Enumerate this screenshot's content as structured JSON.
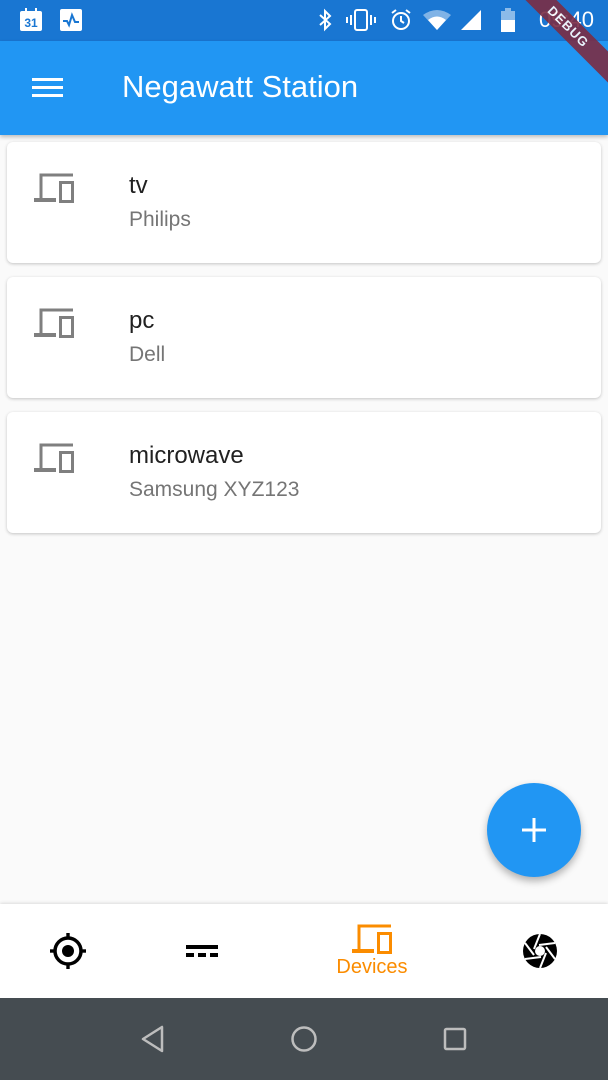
{
  "status_bar": {
    "left_icons": [
      "calendar-icon",
      "pulse-activity-icon"
    ],
    "calendar_day": "31",
    "right_icons": [
      "bluetooth-icon",
      "vibrate-icon",
      "alarm-icon",
      "wifi-icon",
      "signal-icon",
      "battery-icon"
    ],
    "time": "09:40"
  },
  "debug_banner": "DEBUG",
  "app_bar": {
    "menu_icon": "menu-icon",
    "title": "Negawatt Station"
  },
  "devices": [
    {
      "name": "tv",
      "brand": "Philips",
      "icon": "devices-icon"
    },
    {
      "name": "pc",
      "brand": "Dell",
      "icon": "devices-icon"
    },
    {
      "name": "microwave",
      "brand": "Samsung XYZ123",
      "icon": "devices-icon"
    }
  ],
  "fab": {
    "icon": "add-icon",
    "label": "+"
  },
  "bottom_nav": {
    "items": [
      {
        "icon": "gps-fixed-icon",
        "label": "",
        "active": false
      },
      {
        "icon": "power-input-icon",
        "label": "",
        "active": false
      },
      {
        "icon": "devices-icon",
        "label": "Devices",
        "active": true
      },
      {
        "icon": "camera-shutter-icon",
        "label": "",
        "active": false
      }
    ],
    "active_color": "#fb8c00",
    "inactive_color": "#000000"
  },
  "system_nav": [
    "back-icon",
    "home-icon",
    "recents-icon"
  ],
  "colors": {
    "primary": "#2196f3",
    "status_bar": "#1976d2",
    "accent": "#fb8c00",
    "background": "#fafafa"
  }
}
